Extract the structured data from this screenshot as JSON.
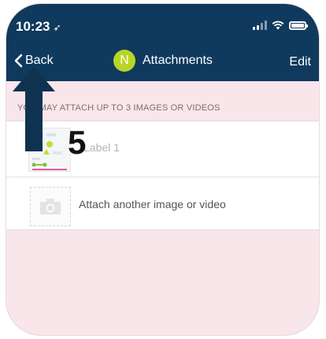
{
  "status_bar": {
    "time": "10:23",
    "icons": [
      "location-arrow-icon",
      "signal-icon",
      "wifi-icon",
      "battery-icon"
    ]
  },
  "nav": {
    "back_label": "Back",
    "avatar_initial": "N",
    "title": "Attachments",
    "edit_label": "Edit"
  },
  "section": {
    "header": "YOU MAY ATTACH UP TO 3 IMAGES OR VIDEOS"
  },
  "attachments": [
    {
      "label": "Label 1"
    }
  ],
  "attach_another_label": "Attach another image or video",
  "annotation": {
    "step_number": "5"
  },
  "colors": {
    "nav_background": "#0f3a5e",
    "avatar": "#b8d625",
    "page_background": "#f9e6ea",
    "annotation_arrow": "#0d3350"
  }
}
